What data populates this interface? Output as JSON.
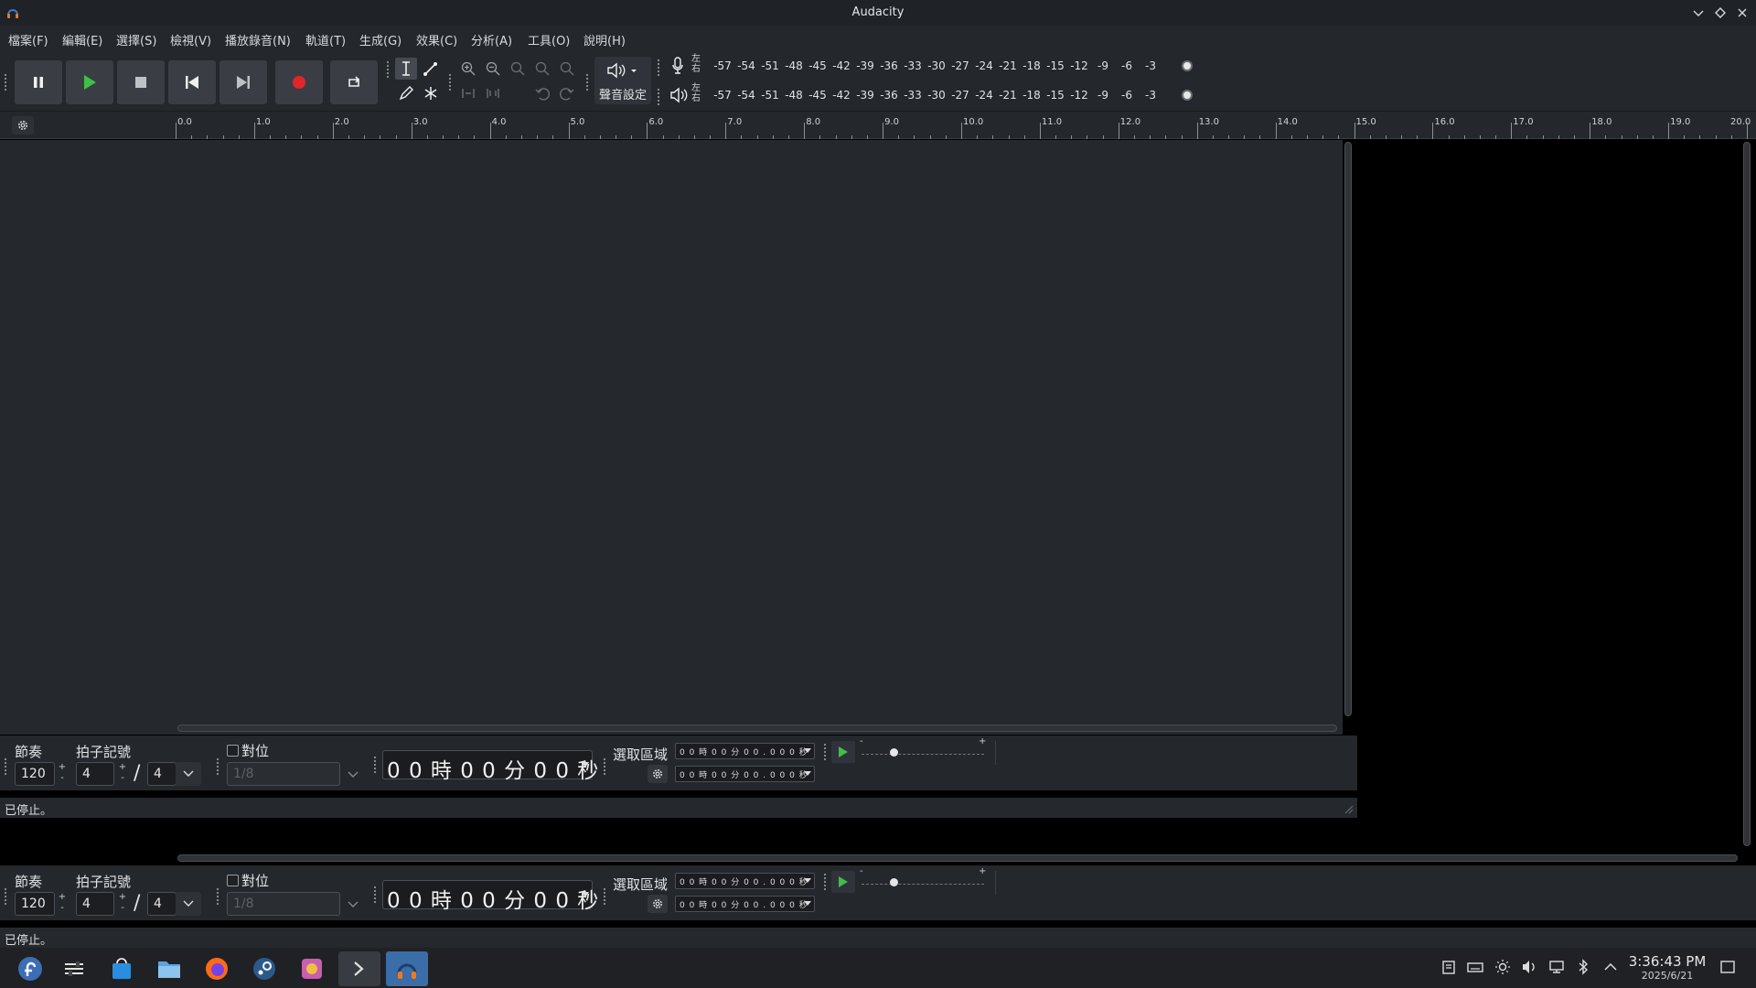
{
  "window": {
    "title": "Audacity"
  },
  "menu": [
    "檔案(F)",
    "編輯(E)",
    "選擇(S)",
    "檢視(V)",
    "播放錄音(N)",
    "軌道(T)",
    "生成(G)",
    "效果(C)",
    "分析(A)",
    "工具(O)",
    "說明(H)"
  ],
  "toolbar": {
    "audio_setup_label": "聲音設定"
  },
  "meters": {
    "channel_label_left": "左",
    "channel_label_right": "右",
    "ticks": [
      "-57",
      "-54",
      "-51",
      "-48",
      "-45",
      "-42",
      "-39",
      "-36",
      "-33",
      "-30",
      "-27",
      "-24",
      "-21",
      "-18",
      "-15",
      "-12",
      "-9",
      "-6",
      "-3"
    ]
  },
  "ruler": {
    "labels": [
      "0.0",
      "1.0",
      "2.0",
      "3.0",
      "4.0",
      "5.0",
      "6.0",
      "7.0",
      "8.0",
      "9.0",
      "10.0",
      "11.0",
      "12.0",
      "13.0",
      "14.0",
      "15.0",
      "16.0",
      "17.0",
      "18.0",
      "19.0",
      "20.0"
    ]
  },
  "bottom": {
    "tempo_label": "節奏",
    "tempo_value": "120",
    "time_sig_label": "拍子記號",
    "time_sig_upper": "4",
    "time_sig_lower": "4",
    "snap_label": "對位",
    "snap_value": "1/8",
    "time_display": "0 0 時 0 0 分 0 0 秒",
    "selection_label": "選取區域",
    "selection_start": "0 0 時 0 0 分 0 0 . 0 0 0 秒",
    "selection_end": "0 0 時 0 0 分 0 0 . 0 0 0 秒",
    "speed_minus": "-",
    "speed_plus": "+",
    "playback_speed": 0.26
  },
  "status": {
    "text": "已停止。"
  },
  "taskbar": {
    "time": "3:36:43 PM",
    "date": "2025/6/21"
  },
  "colors": {
    "record": "#e0262a",
    "play": "#3fbf4a",
    "taskbar_active": "#3b6da8"
  }
}
